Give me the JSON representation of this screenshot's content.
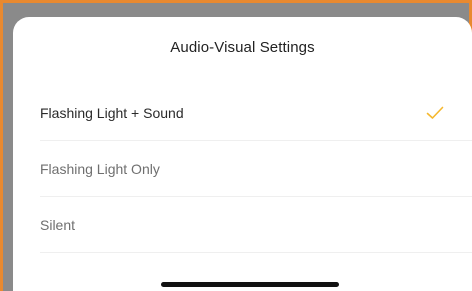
{
  "sheet": {
    "title": "Audio-Visual Settings",
    "options": [
      {
        "label": "Flashing Light + Sound",
        "selected": true
      },
      {
        "label": "Flashing Light Only",
        "selected": false
      },
      {
        "label": "Silent",
        "selected": false
      }
    ]
  },
  "icons": {
    "selected_indicator": "check-icon"
  },
  "colors": {
    "accent": "#f5b82e",
    "frame": "#e8892f"
  }
}
